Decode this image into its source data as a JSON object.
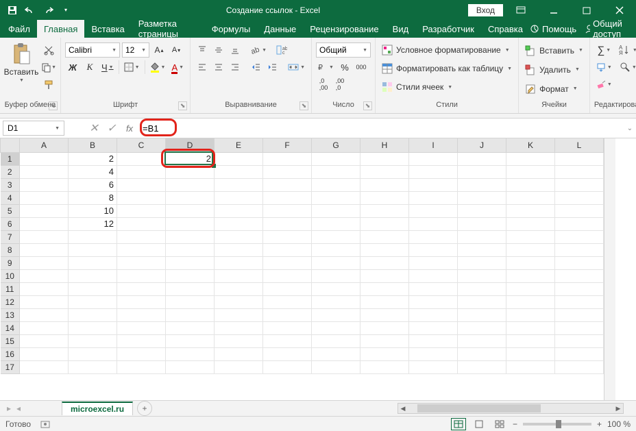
{
  "titlebar": {
    "title": "Создание ссылок - Excel",
    "login": "Вход"
  },
  "tabs": {
    "file": "Файл",
    "home": "Главная",
    "insert": "Вставка",
    "layout": "Разметка страницы",
    "formulas": "Формулы",
    "data": "Данные",
    "review": "Рецензирование",
    "view": "Вид",
    "developer": "Разработчик",
    "help": "Справка",
    "tellme": "Помощь",
    "share": "Общий доступ"
  },
  "ribbon": {
    "clipboard": {
      "label": "Буфер обмена",
      "paste": "Вставить"
    },
    "font": {
      "label": "Шрифт",
      "name": "Calibri",
      "size": "12"
    },
    "alignment": {
      "label": "Выравнивание"
    },
    "number": {
      "label": "Число",
      "format": "Общий"
    },
    "styles": {
      "label": "Стили",
      "conditional": "Условное форматирование",
      "table": "Форматировать как таблицу",
      "cell": "Стили ячеек"
    },
    "cells": {
      "label": "Ячейки",
      "insert": "Вставить",
      "delete": "Удалить",
      "format": "Формат"
    },
    "editing": {
      "label": "Редактирование"
    }
  },
  "namebox": "D1",
  "formula": "=B1",
  "columns": [
    "A",
    "B",
    "C",
    "D",
    "E",
    "F",
    "G",
    "H",
    "I",
    "J",
    "K",
    "L"
  ],
  "rows_count": 17,
  "active": {
    "col": "D",
    "row": 1
  },
  "cells": {
    "B1": "2",
    "B2": "4",
    "B3": "6",
    "B4": "8",
    "B5": "10",
    "B6": "12",
    "D1": "2"
  },
  "sheet": {
    "name": "microexcel.ru"
  },
  "status": {
    "ready": "Готово",
    "zoom": "100 %"
  },
  "chart_data": {
    "type": "table",
    "note": "Excel grid values visible in screenshot",
    "columns": [
      "A",
      "B",
      "C",
      "D"
    ],
    "rows": [
      {
        "row": 1,
        "B": 2,
        "D": 2
      },
      {
        "row": 2,
        "B": 4
      },
      {
        "row": 3,
        "B": 6
      },
      {
        "row": 4,
        "B": 8
      },
      {
        "row": 5,
        "B": 10
      },
      {
        "row": 6,
        "B": 12
      }
    ],
    "formula_in_D1": "=B1"
  }
}
